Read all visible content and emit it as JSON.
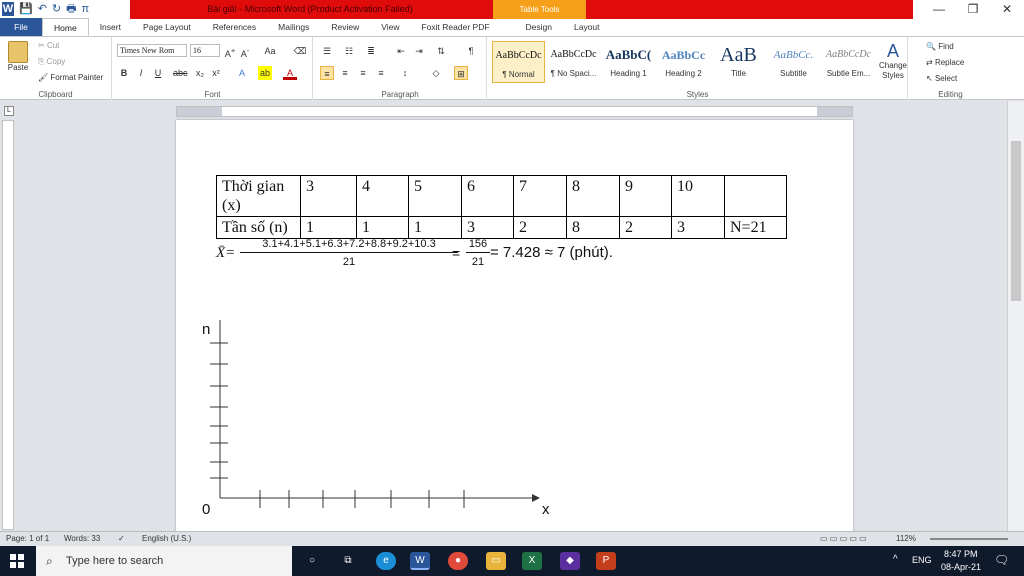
{
  "window": {
    "title": "Bài giải - Microsoft Word (Product Activation Failed)",
    "context_tab": "Table Tools",
    "controls": [
      "—",
      "❐",
      "✕"
    ]
  },
  "qat": {
    "pi": "π"
  },
  "tabs": [
    "File",
    "Home",
    "Insert",
    "Page Layout",
    "References",
    "Mailings",
    "Review",
    "View",
    "Foxit Reader PDF",
    "Design",
    "Layout"
  ],
  "ribbon": {
    "clipboard": {
      "paste": "Paste",
      "cut": "Cut",
      "copy": "Copy",
      "format_painter": "Format Painter",
      "label": "Clipboard"
    },
    "font": {
      "name": "Times New Rom",
      "size": "16",
      "label": "Font"
    },
    "paragraph": {
      "label": "Paragraph"
    },
    "styles": {
      "items": [
        {
          "preview": "AaBbCcDc",
          "name": "¶ Normal"
        },
        {
          "preview": "AaBbCcDc",
          "name": "¶ No Spaci..."
        },
        {
          "preview": "AaBbC(",
          "name": "Heading 1"
        },
        {
          "preview": "AaBbCc",
          "name": "Heading 2"
        },
        {
          "preview": "AaB",
          "name": "Title"
        },
        {
          "preview": "AaBbCc.",
          "name": "Subtitle"
        },
        {
          "preview": "AaBbCcDc",
          "name": "Subtle Em..."
        }
      ],
      "change_styles": "Change Styles",
      "label": "Styles"
    },
    "editing": {
      "find": "Find",
      "replace": "Replace",
      "select": "Select",
      "label": "Editing"
    }
  },
  "document": {
    "table": {
      "row1": [
        "Thời gian (x)",
        "3",
        "4",
        "5",
        "6",
        "7",
        "8",
        "9",
        "10",
        ""
      ],
      "row2": [
        "Tần số (n)",
        "1",
        "1",
        "1",
        "3",
        "2",
        "8",
        "2",
        "3",
        "N=21"
      ]
    },
    "formula": {
      "lhs": "X̄=",
      "numerator": "3.1+4.1+5.1+6.3+7.2+8.8+9.2+10.3",
      "denominator": "21",
      "eq": "=",
      "num2": "156",
      "den2": "21",
      "result": "=  7.428 ≈ 7 (phút)."
    },
    "graph": {
      "y_label": "n",
      "x_label": "x",
      "origin": "0"
    }
  },
  "status": {
    "page": "Page: 1 of 1",
    "words": "Words: 33",
    "language": "English (U.S.)",
    "zoom": "112%"
  },
  "taskbar": {
    "search_placeholder": "Type here to search",
    "lang": "ENG",
    "time": "8:47 PM",
    "date": "08-Apr-21"
  }
}
